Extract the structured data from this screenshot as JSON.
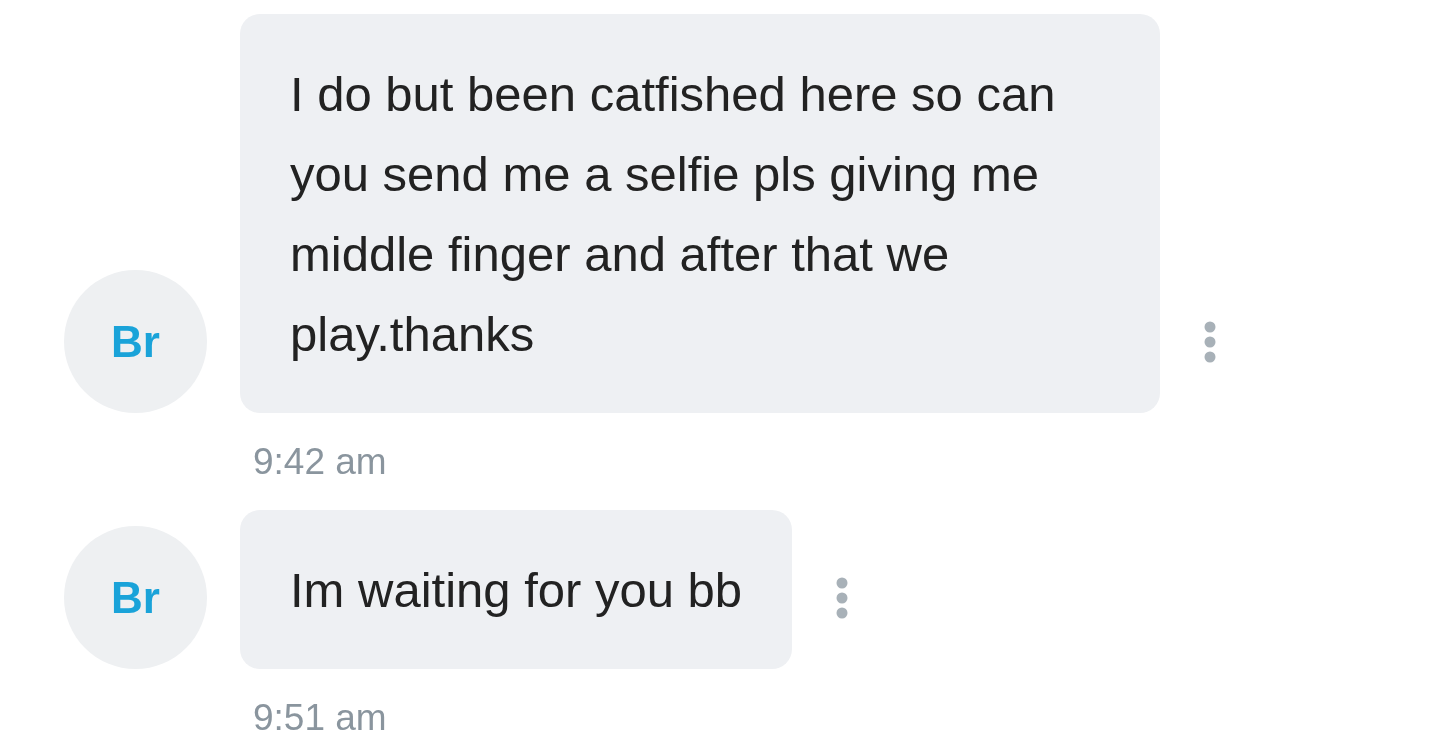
{
  "messages": [
    {
      "avatar": "Br",
      "text": "I do but been catfished here so can you send me a selfie pls giving me middle finger and after that we play.thanks",
      "time": "9:42 am"
    },
    {
      "avatar": "Br",
      "text": "Im waiting for you bb",
      "time": "9:51 am"
    }
  ]
}
